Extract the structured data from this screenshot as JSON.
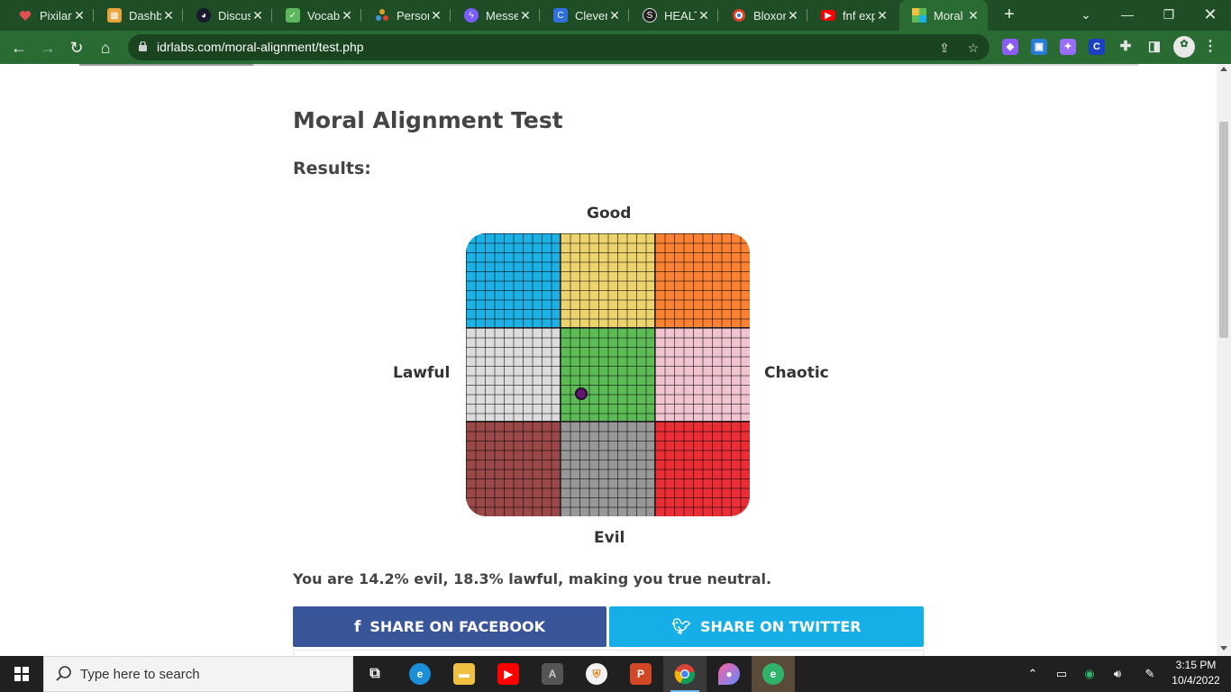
{
  "browser": {
    "tabs": [
      {
        "title": "Pixilart",
        "icon": "heart-icon",
        "color": "#e05050"
      },
      {
        "title": "Dashb",
        "icon": "grid-icon",
        "color": "#e8a33b"
      },
      {
        "title": "Discus",
        "icon": "discussion-icon",
        "color": "#1a1a2e"
      },
      {
        "title": "Vocab",
        "icon": "check-icon",
        "color": "#5cb85c"
      },
      {
        "title": "Person",
        "icon": "people-icon",
        "color": "#e0a030"
      },
      {
        "title": "Messe",
        "icon": "messenger-icon",
        "color": "#7b5cff"
      },
      {
        "title": "Clever",
        "icon": "clever-icon",
        "color": "#2f6fde"
      },
      {
        "title": "HEALT",
        "icon": "s-icon",
        "color": "#222222"
      },
      {
        "title": "Bloxor",
        "icon": "target-icon",
        "color": "#d9432f"
      },
      {
        "title": "fnf exp",
        "icon": "youtube-icon",
        "color": "#ff0000"
      },
      {
        "title": "Moral",
        "icon": "idrlabs-icon",
        "color": "#f0c040",
        "active": true
      }
    ],
    "address": {
      "url": "idrlabs.com/moral-alignment/test.php"
    }
  },
  "page": {
    "title": "Moral Alignment Test",
    "results_label": "Results:",
    "axes": {
      "top": "Good",
      "bottom": "Evil",
      "left": "Lawful",
      "right": "Chaotic"
    },
    "alignment_grid": {
      "cells": [
        {
          "name": "lawful-good",
          "color": "#1cb0e4"
        },
        {
          "name": "neutral-good",
          "color": "#edd36e"
        },
        {
          "name": "chaotic-good",
          "color": "#fb8133"
        },
        {
          "name": "lawful-neutral",
          "color": "#dcdcdc"
        },
        {
          "name": "true-neutral",
          "color": "#5dbb55"
        },
        {
          "name": "chaotic-neutral",
          "color": "#f2c4d0"
        },
        {
          "name": "lawful-evil",
          "color": "#9a4848"
        },
        {
          "name": "neutral-evil",
          "color": "#989898"
        },
        {
          "name": "chaotic-evil",
          "color": "#ea2e36"
        }
      ],
      "result": {
        "evil_percent": 14.2,
        "lawful_percent": 18.3
      }
    },
    "result_text": "You are 14.2% evil, 18.3% lawful, making you true neutral.",
    "share": {
      "facebook_label": "SHARE ON FACEBOOK",
      "facebook_color": "#3a569a",
      "twitter_label": "SHARE ON TWITTER",
      "twitter_color": "#15aee6"
    }
  },
  "taskbar": {
    "search_placeholder": "Type here to search",
    "time": "3:15 PM",
    "date": "10/4/2022"
  }
}
